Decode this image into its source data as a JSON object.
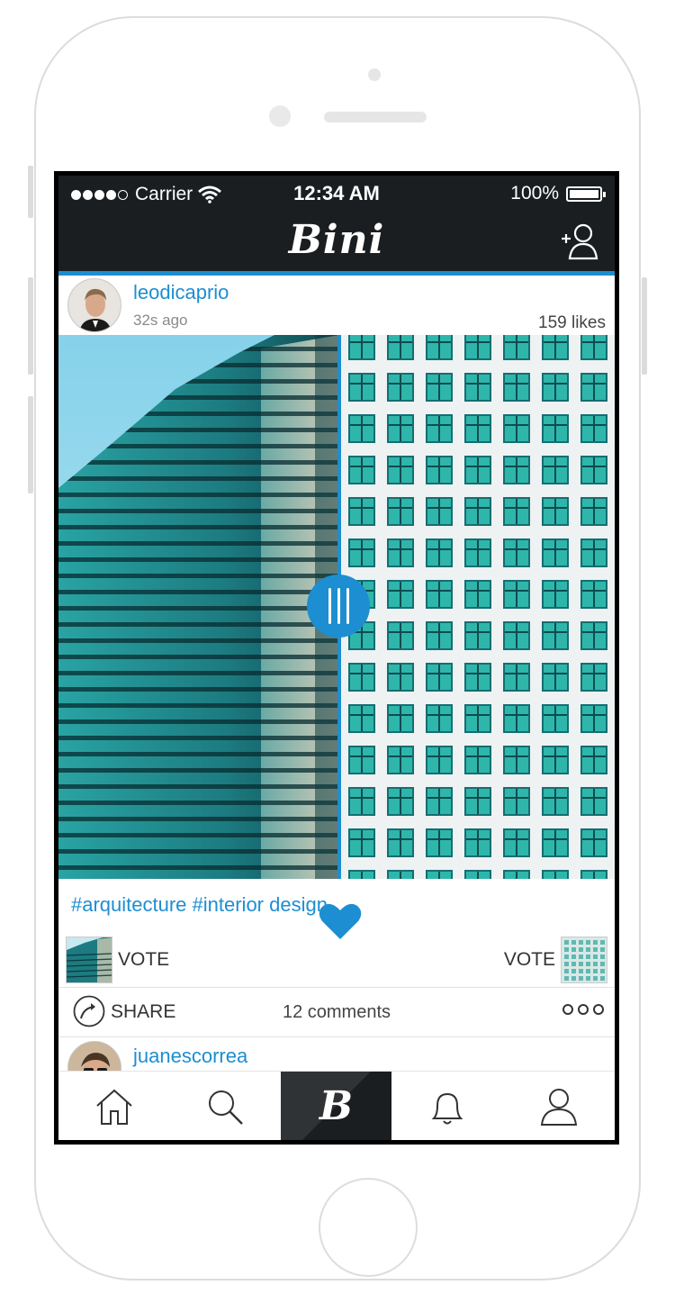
{
  "status_bar": {
    "carrier": "Carrier",
    "time": "12:34 AM",
    "battery": "100%"
  },
  "header": {
    "logo": "Bini"
  },
  "post": {
    "username": "leodicaprio",
    "time_ago": "32s ago",
    "likes": "159 likes",
    "tags": "#arquitecture #interior design",
    "vote_left": "VOTE",
    "vote_right": "VOTE",
    "share": "SHARE",
    "comments": "12 comments"
  },
  "next_post": {
    "username": "juanescorrea"
  },
  "tabbar": {
    "active_logo": "B"
  },
  "colors": {
    "accent": "#1d8ed1",
    "bar": "#1b1e20"
  }
}
